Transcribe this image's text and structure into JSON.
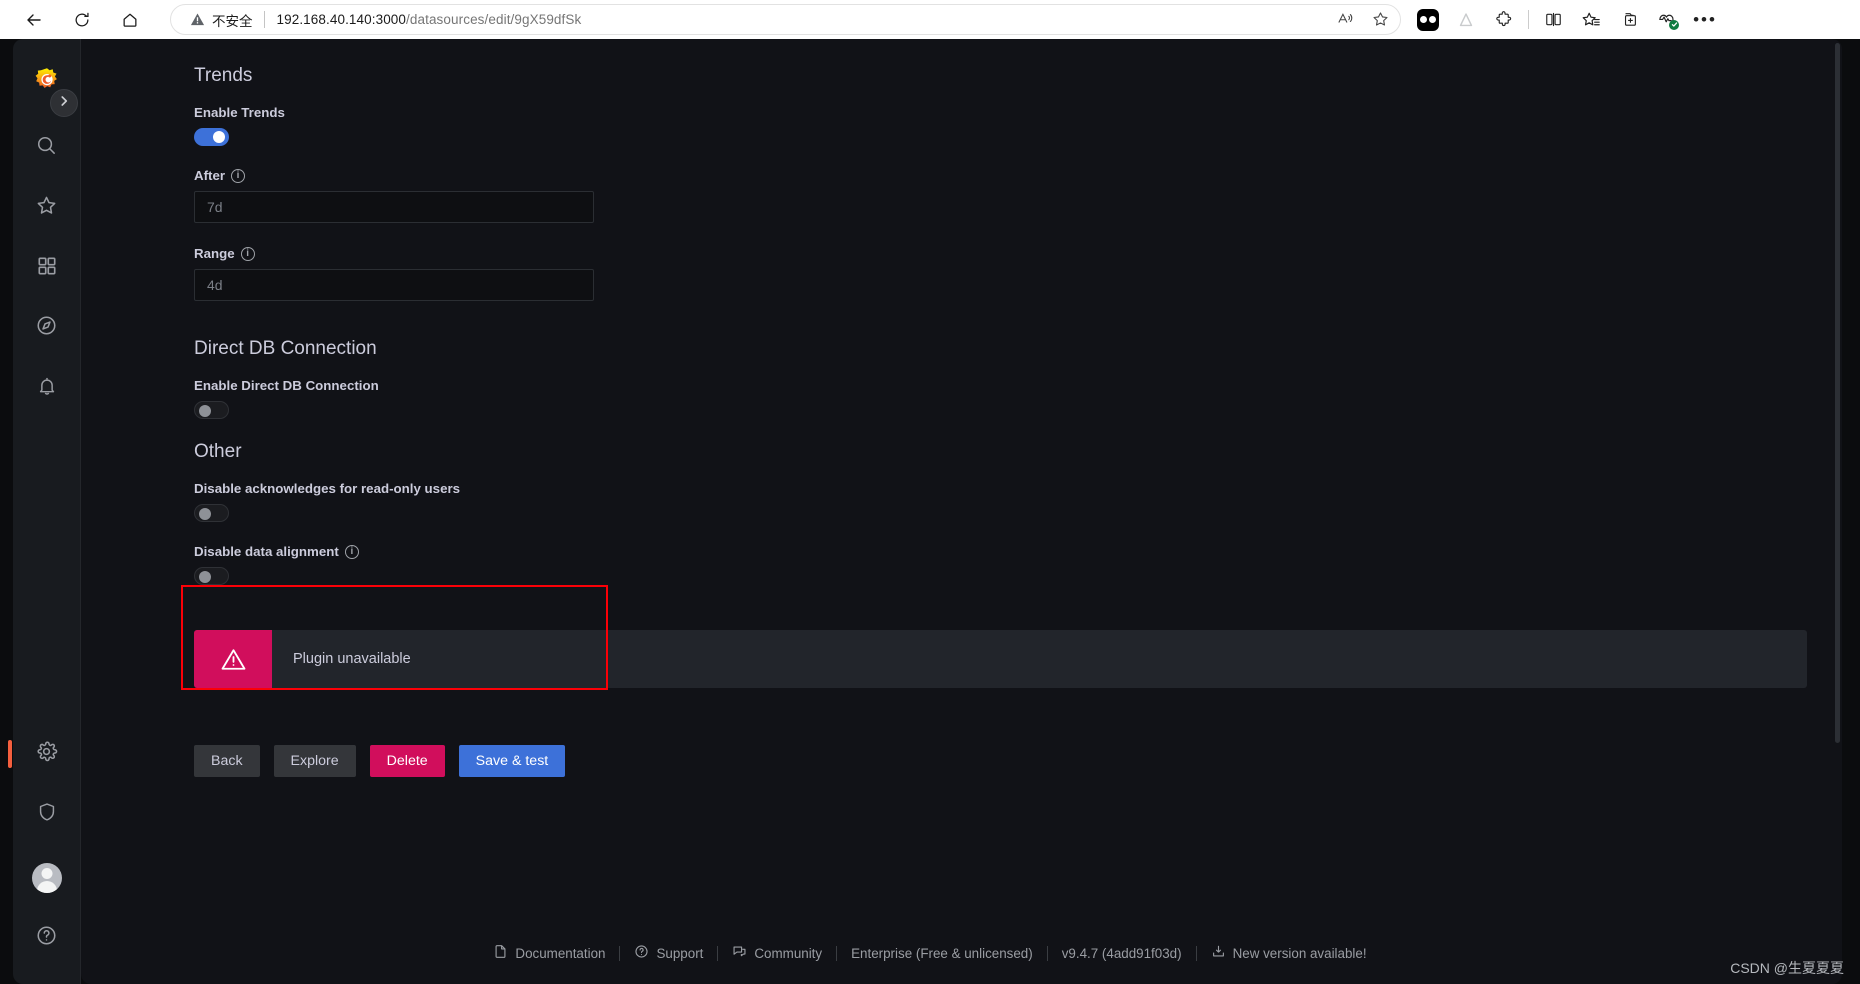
{
  "browser": {
    "security_label": "不安全",
    "url_host": "192.168.40.140:3000",
    "url_path": "/datasources/edit/9gX59dfSk",
    "nav": {
      "back": "back-arrow",
      "reload": "reload",
      "home": "home"
    },
    "omnibox_icons": [
      "read-aloud",
      "add-favorite"
    ],
    "toolbar_icons": [
      "profile-chip",
      "brand-a",
      "extensions",
      "split-screen",
      "favorites",
      "collections",
      "browser-essentials",
      "settings-and-more"
    ]
  },
  "sidebar": {
    "logo": "grafana-logo",
    "expand_label": "expand-menu",
    "items": [
      {
        "name": "search",
        "icon": "search-icon"
      },
      {
        "name": "starred",
        "icon": "star-icon"
      },
      {
        "name": "dashboards",
        "icon": "grid-icon"
      },
      {
        "name": "explore",
        "icon": "compass-icon"
      },
      {
        "name": "alerting",
        "icon": "bell-icon"
      }
    ],
    "bottom_items": [
      {
        "name": "configuration",
        "icon": "gear-icon",
        "active": true
      },
      {
        "name": "server-admin",
        "icon": "shield-icon",
        "active": false
      },
      {
        "name": "profile",
        "icon": "avatar",
        "active": false
      },
      {
        "name": "help",
        "icon": "question-circle-icon",
        "active": false
      }
    ]
  },
  "main": {
    "trends": {
      "title": "Trends",
      "enable_label": "Enable Trends",
      "enable_value": true,
      "after_label": "After",
      "after_placeholder": "7d",
      "after_value": "",
      "range_label": "Range",
      "range_placeholder": "4d",
      "range_value": ""
    },
    "direct_db": {
      "title": "Direct DB Connection",
      "enable_label": "Enable Direct DB Connection",
      "enable_value": false
    },
    "other": {
      "title": "Other",
      "disable_ack_label": "Disable acknowledges for read-only users",
      "disable_ack_value": false,
      "disable_alignment_label": "Disable data alignment",
      "disable_alignment_value": false
    },
    "alert": {
      "icon": "warning-triangle-icon",
      "message": "Plugin unavailable",
      "icon_color": "#d10e5c"
    },
    "buttons": {
      "back": "Back",
      "explore": "Explore",
      "delete": "Delete",
      "save_test": "Save & test"
    }
  },
  "footer": {
    "documentation": "Documentation",
    "support": "Support",
    "community": "Community",
    "enterprise": "Enterprise (Free & unlicensed)",
    "version": "v9.4.7 (4add91f03d)",
    "new_version": "New version available!"
  },
  "watermark": "CSDN @生夏夏夏",
  "colors": {
    "accent_blue": "#3d71d9",
    "danger_pink": "#d10e5c",
    "active_orange": "#f55f3e",
    "annotation_red": "#fb0007"
  }
}
